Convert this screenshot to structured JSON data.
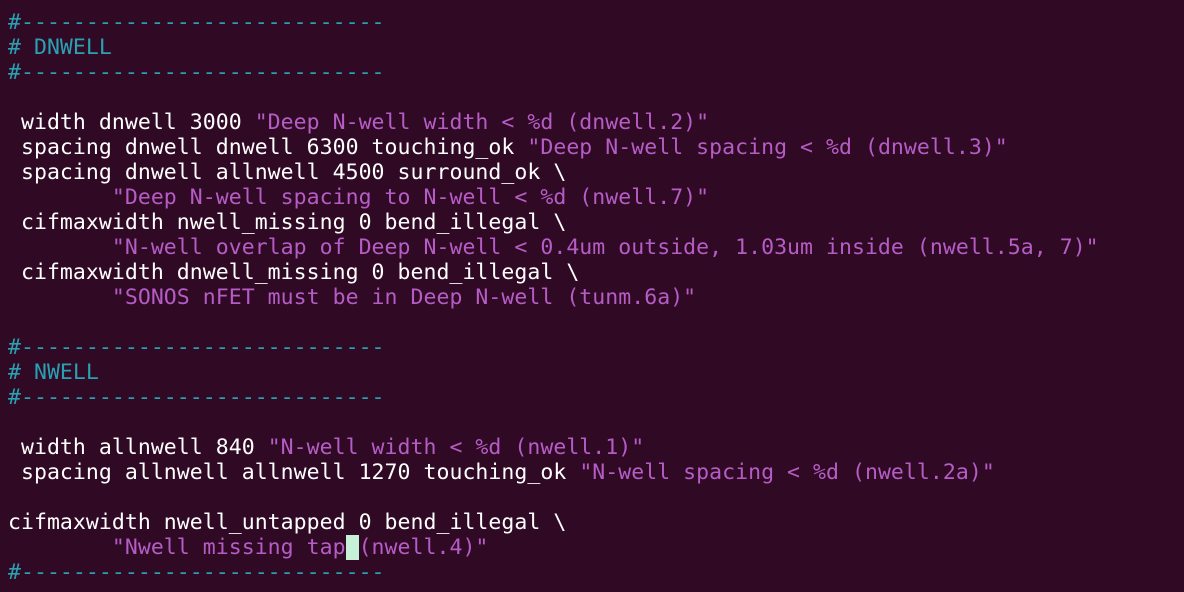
{
  "terminal": {
    "lines": [
      {
        "segments": [
          {
            "kind": "cmt",
            "text": "#----------------------------"
          }
        ]
      },
      {
        "segments": [
          {
            "kind": "cmt",
            "text": "# DNWELL"
          }
        ]
      },
      {
        "segments": [
          {
            "kind": "cmt",
            "text": "#----------------------------"
          }
        ]
      },
      {
        "segments": []
      },
      {
        "segments": [
          {
            "kind": "code",
            "text": " width dnwell 3000 "
          },
          {
            "kind": "str",
            "text": "\"Deep N-well width < %d (dnwell.2)\""
          }
        ]
      },
      {
        "segments": [
          {
            "kind": "code",
            "text": " spacing dnwell dnwell 6300 touching_ok "
          },
          {
            "kind": "str",
            "text": "\"Deep N-well spacing < %d (dnwell.3)\""
          }
        ]
      },
      {
        "segments": [
          {
            "kind": "code",
            "text": " spacing dnwell allnwell 4500 surround_ok \\"
          }
        ]
      },
      {
        "segments": [
          {
            "kind": "code",
            "text": "        "
          },
          {
            "kind": "str",
            "text": "\"Deep N-well spacing to N-well < %d (nwell.7)\""
          }
        ]
      },
      {
        "segments": [
          {
            "kind": "code",
            "text": " cifmaxwidth nwell_missing 0 bend_illegal \\"
          }
        ]
      },
      {
        "segments": [
          {
            "kind": "code",
            "text": "        "
          },
          {
            "kind": "str",
            "text": "\"N-well overlap of Deep N-well < 0.4um outside, 1.03um inside (nwell.5a, 7)\""
          }
        ]
      },
      {
        "segments": [
          {
            "kind": "code",
            "text": " cifmaxwidth dnwell_missing 0 bend_illegal \\"
          }
        ]
      },
      {
        "segments": [
          {
            "kind": "code",
            "text": "        "
          },
          {
            "kind": "str",
            "text": "\"SONOS nFET must be in Deep N-well (tunm.6a)\""
          }
        ]
      },
      {
        "segments": []
      },
      {
        "segments": [
          {
            "kind": "cmt",
            "text": "#----------------------------"
          }
        ]
      },
      {
        "segments": [
          {
            "kind": "cmt",
            "text": "# NWELL"
          }
        ]
      },
      {
        "segments": [
          {
            "kind": "cmt",
            "text": "#----------------------------"
          }
        ]
      },
      {
        "segments": []
      },
      {
        "segments": [
          {
            "kind": "code",
            "text": " width allnwell 840 "
          },
          {
            "kind": "str",
            "text": "\"N-well width < %d (nwell.1)\""
          }
        ]
      },
      {
        "segments": [
          {
            "kind": "code",
            "text": " spacing allnwell allnwell 1270 touching_ok "
          },
          {
            "kind": "str",
            "text": "\"N-well spacing < %d (nwell.2a)\""
          }
        ]
      },
      {
        "segments": []
      },
      {
        "segments": [
          {
            "kind": "code",
            "text": "cifmaxwidth nwell_untapped 0 bend_illegal \\"
          }
        ]
      },
      {
        "segments": [
          {
            "kind": "code",
            "text": "        "
          },
          {
            "kind": "str",
            "text": "\"Nwell missing tap"
          },
          {
            "kind": "cursor",
            "text": " "
          },
          {
            "kind": "str",
            "text": "(nwell.4)\""
          }
        ]
      },
      {
        "segments": [
          {
            "kind": "cmt",
            "text": "#----------------------------"
          }
        ]
      }
    ]
  }
}
